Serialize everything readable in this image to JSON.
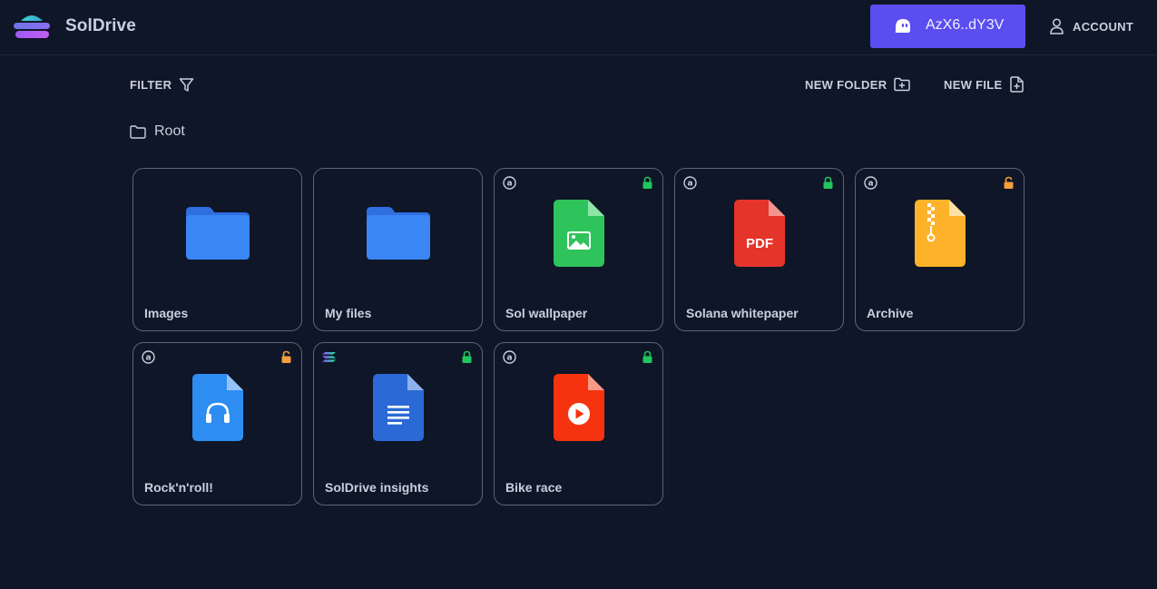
{
  "app": {
    "brand": "SolDrive",
    "wallet_address": "AzX6..dY3V",
    "account_label": "ACCOUNT"
  },
  "toolbar": {
    "filter_label": "FILTER",
    "new_folder_label": "NEW FOLDER",
    "new_file_label": "NEW FILE"
  },
  "breadcrumb": {
    "label": "Root"
  },
  "colors": {
    "background": "#0f1628",
    "accent": "#5a4ef0",
    "lock_locked": "#22c55e",
    "lock_unlocked": "#f59e3b"
  },
  "items": [
    {
      "name": "Images",
      "kind": "folder"
    },
    {
      "name": "My files",
      "kind": "folder"
    },
    {
      "name": "Sol wallpaper",
      "kind": "image",
      "visibility": "at-icon",
      "lock": "locked"
    },
    {
      "name": "Solana whitepaper",
      "kind": "pdf",
      "badge": "PDF",
      "visibility": "at-icon",
      "lock": "locked"
    },
    {
      "name": "Archive",
      "kind": "zip",
      "visibility": "at-icon",
      "lock": "unlocked"
    },
    {
      "name": "Rock'n'roll!",
      "kind": "audio",
      "visibility": "at-icon",
      "lock": "unlocked"
    },
    {
      "name": "SolDrive insights",
      "kind": "doc",
      "visibility": "solana-icon",
      "lock": "locked"
    },
    {
      "name": "Bike race",
      "kind": "video",
      "visibility": "at-icon",
      "lock": "locked"
    }
  ]
}
